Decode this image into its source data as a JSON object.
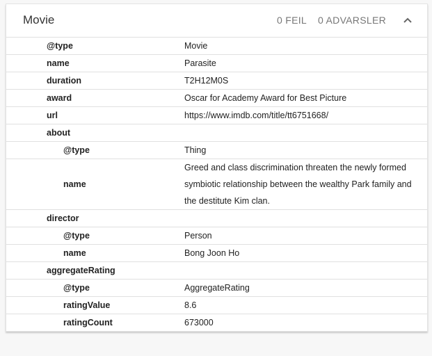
{
  "header": {
    "title": "Movie",
    "errors": "0 FEIL",
    "warnings": "0 ADVARSLER"
  },
  "rows": [
    {
      "key": "@type",
      "value": "Movie",
      "level": 0
    },
    {
      "key": "name",
      "value": "Parasite",
      "level": 0
    },
    {
      "key": "duration",
      "value": "T2H12M0S",
      "level": 0
    },
    {
      "key": "award",
      "value": "Oscar for Academy Award for Best Picture",
      "level": 0
    },
    {
      "key": "url",
      "value": "https://www.imdb.com/title/tt6751668/",
      "level": 0
    },
    {
      "key": "about",
      "value": "",
      "level": 0
    },
    {
      "key": "@type",
      "value": "Thing",
      "level": 1
    },
    {
      "key": "name",
      "value": "Greed and class discrimination threaten the newly formed symbiotic relationship between the wealthy Park family and the destitute Kim clan.",
      "level": 1
    },
    {
      "key": "director",
      "value": "",
      "level": 0
    },
    {
      "key": "@type",
      "value": "Person",
      "level": 1
    },
    {
      "key": "name",
      "value": "Bong Joon Ho",
      "level": 1
    },
    {
      "key": "aggregateRating",
      "value": "",
      "level": 0
    },
    {
      "key": "@type",
      "value": "AggregateRating",
      "level": 1
    },
    {
      "key": "ratingValue",
      "value": "8.6",
      "level": 1
    },
    {
      "key": "ratingCount",
      "value": "673000",
      "level": 1
    }
  ]
}
